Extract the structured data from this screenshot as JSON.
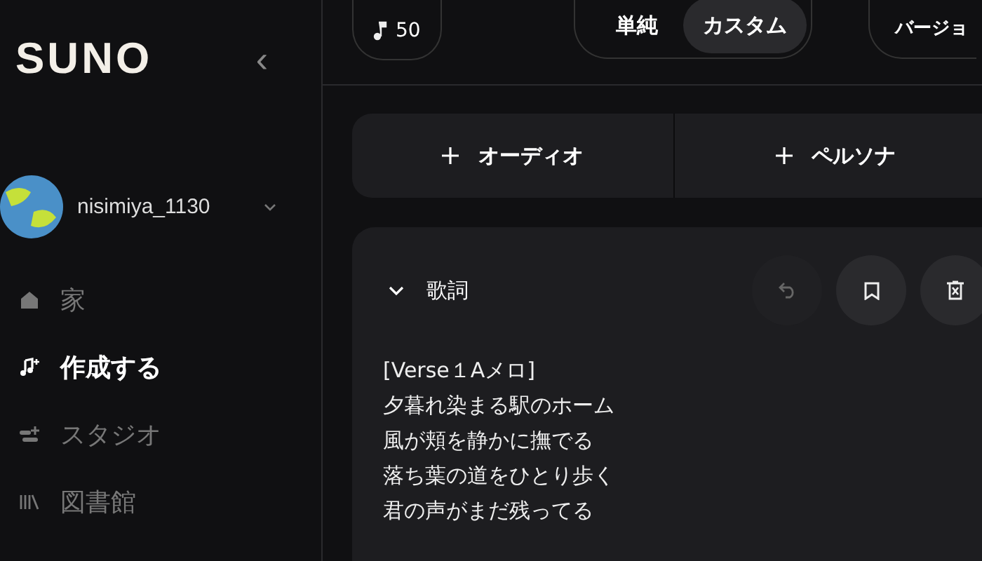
{
  "sidebar": {
    "logo": "SUNO",
    "collapse_icon": "‹",
    "user": {
      "name": "nisimiya_1130"
    },
    "items": [
      {
        "label": "家",
        "kind": "home",
        "selected": false
      },
      {
        "label": "作成する",
        "kind": "create",
        "selected": true
      },
      {
        "label": "スタジオ",
        "kind": "studio",
        "selected": false
      },
      {
        "label": "図書館",
        "kind": "library",
        "selected": false
      }
    ]
  },
  "topbar": {
    "credits": "50",
    "modes": [
      {
        "label": "単純",
        "selected": false
      },
      {
        "label": "カスタム",
        "selected": true
      }
    ],
    "version": "バージョ"
  },
  "add_buttons": [
    {
      "label": "オーディオ"
    },
    {
      "label": "ペルソナ"
    }
  ],
  "lyrics": {
    "title": "歌詞",
    "expanded": true,
    "tools": [
      {
        "kind": "undo",
        "disabled": true
      },
      {
        "kind": "bookmark",
        "disabled": false
      },
      {
        "kind": "delete",
        "disabled": false
      }
    ],
    "lines": [
      "[Verse１Aメロ]",
      "夕暮れ染まる駅のホーム",
      "風が頬を静かに撫でる",
      "落ち葉の道をひとり歩く",
      "君の声がまだ残ってる"
    ]
  }
}
